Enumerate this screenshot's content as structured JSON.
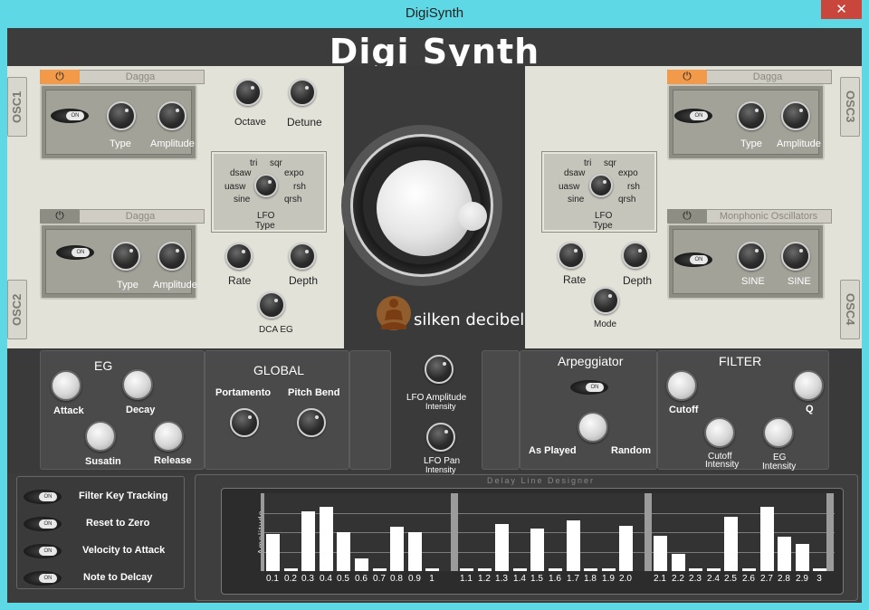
{
  "window": {
    "title": "DigiSynth",
    "close_glyph": "✕"
  },
  "brand": {
    "title": "Digi Synth",
    "logo_text": "silken decibel"
  },
  "osc_tabs": {
    "osc1": "OSC1",
    "osc2": "OSC2",
    "osc3": "OSC3",
    "osc4": "OSC4"
  },
  "osc1": {
    "power": "⏻",
    "name": "Dagga",
    "toggle": "ON",
    "type": "Type",
    "amplitude": "Amplitude"
  },
  "osc2": {
    "power": "⏻",
    "name": "Dagga",
    "toggle": "ON",
    "type": "Type",
    "amplitude": "Amplitude"
  },
  "osc3": {
    "power": "⏻",
    "name": "Dagga",
    "toggle": "ON",
    "type": "Type",
    "amplitude": "Amplitude"
  },
  "osc4": {
    "power": "⏻",
    "name": "Monphonic Oscillators",
    "toggle": "ON",
    "knob1": "SINE",
    "knob2": "SINE"
  },
  "left_lfo": {
    "octave": "Octave",
    "detune": "Detune",
    "waves": {
      "tri": "tri",
      "sqr": "sqr",
      "dsaw": "dsaw",
      "expo": "expo",
      "uasw": "uasw",
      "rsh": "rsh",
      "sine": "sine",
      "qrsh": "qrsh"
    },
    "lfo": "LFO",
    "type": "Type",
    "rate": "Rate",
    "depth": "Depth",
    "dca_eg": "DCA EG"
  },
  "right_lfo": {
    "waves": {
      "tri": "tri",
      "sqr": "sqr",
      "dsaw": "dsaw",
      "expo": "expo",
      "uasw": "uasw",
      "rsh": "rsh",
      "sine": "sine",
      "qrsh": "qrsh"
    },
    "lfo": "LFO",
    "type": "Type",
    "rate": "Rate",
    "depth": "Depth",
    "mode": "Mode"
  },
  "eg": {
    "title": "EG",
    "attack": "Attack",
    "decay": "Decay",
    "sustain": "Susatin",
    "release": "Release"
  },
  "global": {
    "title": "GLOBAL",
    "portamento": "Portamento",
    "pitch_bend": "Pitch Bend"
  },
  "center_lfo": {
    "amp_line1": "LFO Amplitude",
    "amp_line2": "Intensity",
    "pan_line1": "LFO Pan",
    "pan_line2": "Intensity"
  },
  "arpeggiator": {
    "title": "Arpeggiator",
    "toggle": "ON",
    "as_played": "As Played",
    "random": "Random"
  },
  "filter": {
    "title": "FILTER",
    "cutoff": "Cutoff",
    "q": "Q",
    "cutoff_int1": "Cutoff",
    "cutoff_int2": "Intensity",
    "eg_int1": "EG",
    "eg_int2": "Intensity"
  },
  "options": [
    {
      "label": "Filter Key Tracking",
      "toggle": "ON"
    },
    {
      "label": "Reset to Zero",
      "toggle": "ON"
    },
    {
      "label": "Velocity to Attack",
      "toggle": "ON"
    },
    {
      "label": "Note to Delcay",
      "toggle": "ON"
    }
  ],
  "delay": {
    "title": "Delay Line Designer",
    "ylabel": "Amplitude"
  },
  "chart_data": {
    "type": "bar",
    "title": "Delay Line Designer",
    "ylabel": "Amplitude",
    "ylim": [
      0,
      1
    ],
    "grid": true,
    "groups": [
      {
        "categories": [
          "0.1",
          "0.2",
          "0.3",
          "0.4",
          "0.5",
          "0.6",
          "0.7",
          "0.8",
          "0.9",
          "1"
        ],
        "values": [
          0.48,
          0.03,
          0.77,
          0.83,
          0.5,
          0.16,
          0.03,
          0.57,
          0.5,
          0.03
        ]
      },
      {
        "categories": [
          "1.1",
          "1.2",
          "1.3",
          "1.4",
          "1.5",
          "1.6",
          "1.7",
          "1.8",
          "1.9",
          "2.0"
        ],
        "values": [
          0.03,
          0.03,
          0.61,
          0.03,
          0.55,
          0.03,
          0.65,
          0.03,
          0.03,
          0.58
        ]
      },
      {
        "categories": [
          "2.1",
          "2.2",
          "2.3",
          "2.4",
          "2.5",
          "2.6",
          "2.7",
          "2.8",
          "2.9",
          "3"
        ],
        "values": [
          0.45,
          0.22,
          0.03,
          0.03,
          0.7,
          0.03,
          0.83,
          0.44,
          0.35,
          0.03
        ]
      }
    ]
  }
}
